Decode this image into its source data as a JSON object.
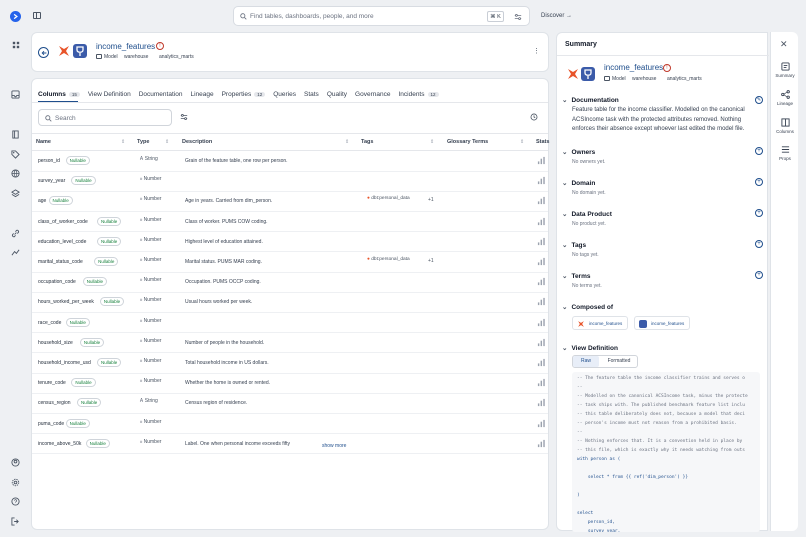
{
  "topbar": {
    "search_placeholder": "Find tables, dashboards, people, and more",
    "kbd": "⌘ K",
    "discover": "Discover"
  },
  "header": {
    "title": "income_features",
    "type": "Model",
    "crumbs": [
      "warehouse",
      "analytics_marts"
    ]
  },
  "tabs": [
    {
      "label": "Columns",
      "count": "15"
    },
    {
      "label": "View Definition",
      "count": ""
    },
    {
      "label": "Documentation",
      "count": ""
    },
    {
      "label": "Lineage",
      "count": ""
    },
    {
      "label": "Properties",
      "count": "12"
    },
    {
      "label": "Queries",
      "count": ""
    },
    {
      "label": "Stats",
      "count": ""
    },
    {
      "label": "Quality",
      "count": ""
    },
    {
      "label": "Governance",
      "count": ""
    },
    {
      "label": "Incidents",
      "count": "12"
    }
  ],
  "table_search_placeholder": "Search",
  "columns_header": {
    "name": "Name",
    "type": "Type",
    "description": "Description",
    "tags": "Tags",
    "glossary": "Glossary Terms",
    "stats": "Stats"
  },
  "nullable_label": "Nullable",
  "show_more": "show more",
  "rows": [
    {
      "name": "person_id",
      "type": "String",
      "desc": "Grain of the feature table, one row per person.",
      "tag": "",
      "plus": ""
    },
    {
      "name": "survey_year",
      "type": "Number",
      "desc": "",
      "tag": "",
      "plus": ""
    },
    {
      "name": "age",
      "type": "Number",
      "desc": "Age in years. Carried from dim_person.",
      "tag": "dbt:personal_data",
      "plus": "+1"
    },
    {
      "name": "class_of_worker_code",
      "type": "Number",
      "desc": "Class of worker. PUMS COW coding.",
      "tag": "",
      "plus": ""
    },
    {
      "name": "education_level_code",
      "type": "Number",
      "desc": "Highest level of education attained.",
      "tag": "",
      "plus": ""
    },
    {
      "name": "marital_status_code",
      "type": "Number",
      "desc": "Marital status. PUMS MAR coding.",
      "tag": "dbt:personal_data",
      "plus": "+1"
    },
    {
      "name": "occupation_code",
      "type": "Number",
      "desc": "Occupation. PUMS OCCP coding.",
      "tag": "",
      "plus": ""
    },
    {
      "name": "hours_worked_per_week",
      "type": "Number",
      "desc": "Usual hours worked per week.",
      "tag": "",
      "plus": ""
    },
    {
      "name": "race_code",
      "type": "Number",
      "desc": "",
      "tag": "",
      "plus": ""
    },
    {
      "name": "household_size",
      "type": "Number",
      "desc": "Number of people in the household.",
      "tag": "",
      "plus": ""
    },
    {
      "name": "household_income_usd",
      "type": "Number",
      "desc": "Total household income in US dollars.",
      "tag": "",
      "plus": ""
    },
    {
      "name": "tenure_code",
      "type": "Number",
      "desc": "Whether the home is owned or rented.",
      "tag": "",
      "plus": ""
    },
    {
      "name": "census_region",
      "type": "String",
      "desc": "Census region of residence.",
      "tag": "",
      "plus": ""
    },
    {
      "name": "puma_code",
      "type": "Number",
      "desc": "",
      "tag": "",
      "plus": ""
    },
    {
      "name": "income_above_50k",
      "type": "Number",
      "desc": "Label. One when personal income exceeds fifty",
      "tag": "",
      "plus": ""
    }
  ],
  "summary": {
    "heading": "Summary",
    "title": "income_features",
    "type": "Model",
    "crumbs": [
      "warehouse",
      "analytics_marts"
    ],
    "documentation_label": "Documentation",
    "documentation": "Feature table for the income classifier. Modelled on the canonical ACSIncome task with the protected attributes removed. Nothing enforces their absence except whoever last edited the model file.",
    "owners_label": "Owners",
    "owners_value": "No owners yet.",
    "domain_label": "Domain",
    "domain_value": "No domain yet.",
    "data_product_label": "Data Product",
    "data_product_value": "No product yet.",
    "tags_label": "Tags",
    "tags_value": "No tags yet.",
    "terms_label": "Terms",
    "terms_value": "No terms yet.",
    "composed_label": "Composed of",
    "composed": [
      "income_features",
      "income_features"
    ],
    "view_def_label": "View Definition",
    "raw": "Raw",
    "formatted": "Formatted",
    "code": [
      "-- The feature table the income classifier trains and serves o",
      "--",
      "-- Modelled on the canonical ACSIncome task, minus the protecte",
      "-- task ships with. The published benchmark feature list inclu",
      "-- this table deliberately does not, because a model that deci",
      "-- person's income must not reason from a prohibited basis.",
      "--",
      "-- Nothing enforces that. It is a convention held in place by",
      "-- this file, which is exactly why it needs watching from outs",
      "with person as (",
      "",
      "    select * from {{ ref('dim_person') }}",
      "",
      ")",
      "",
      "select",
      "    person_id,",
      "    survey_year,"
    ]
  },
  "right_sidebar": [
    "Summary",
    "Lineage",
    "Columns",
    "Props"
  ]
}
